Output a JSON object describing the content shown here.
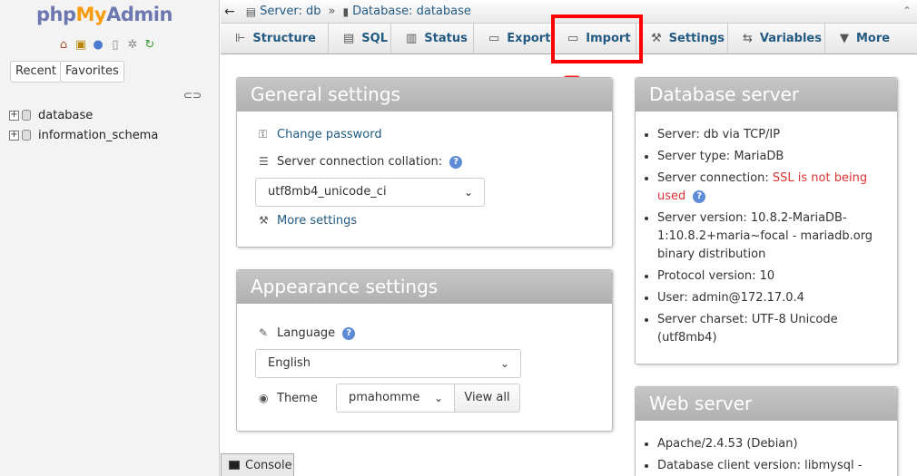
{
  "logo": {
    "php": "php",
    "my": "My",
    "admin": "Admin"
  },
  "nav": {
    "icons": [
      "home-icon",
      "exit-icon",
      "help-icon",
      "docs-icon",
      "settings-icon",
      "reload-icon"
    ],
    "recent_label": "Recent",
    "favorites_label": "Favorites",
    "databases": [
      "database",
      "information_schema"
    ]
  },
  "breadcrumb": {
    "server": "Server: db",
    "separator": "»",
    "database": "Database: database"
  },
  "tabs": [
    {
      "label": "Structure",
      "icon": "structure-icon"
    },
    {
      "label": "SQL",
      "icon": "sql-icon"
    },
    {
      "label": "Status",
      "icon": "status-icon"
    },
    {
      "label": "Export",
      "icon": "export-icon"
    },
    {
      "label": "Import",
      "icon": "import-icon"
    },
    {
      "label": "Settings",
      "icon": "wrench-icon"
    },
    {
      "label": "Variables",
      "icon": "variables-icon"
    },
    {
      "label": "More",
      "icon": "caret-down-icon"
    }
  ],
  "general": {
    "title": "General settings",
    "change_password": "Change password",
    "collation_label": "Server connection collation:",
    "collation_value": "utf8mb4_unicode_ci",
    "more_settings": "More settings"
  },
  "appearance": {
    "title": "Appearance settings",
    "language_label": "Language",
    "language_value": "English",
    "theme_label": "Theme",
    "theme_value": "pmahomme",
    "view_all": "View all"
  },
  "db_server": {
    "title": "Database server",
    "server": "Server: db via TCP/IP",
    "type": "Server type: MariaDB",
    "connection_prefix": "Server connection: ",
    "connection_warn": "SSL is not being used",
    "version": "Server version: 10.8.2-MariaDB-1:10.8.2+maria~focal - mariadb.org binary distribution",
    "protocol": "Protocol version: 10",
    "user": "User: admin@172.17.0.4",
    "charset": "Server charset: UTF-8 Unicode (utf8mb4)"
  },
  "web_server": {
    "title": "Web server",
    "apache": "Apache/2.4.53 (Debian)",
    "client": "Database client version: libmysql -"
  },
  "console_label": "Console",
  "colors": {
    "link": "#235a81",
    "annotation": "#ff0000",
    "warning": "#dd3333"
  }
}
